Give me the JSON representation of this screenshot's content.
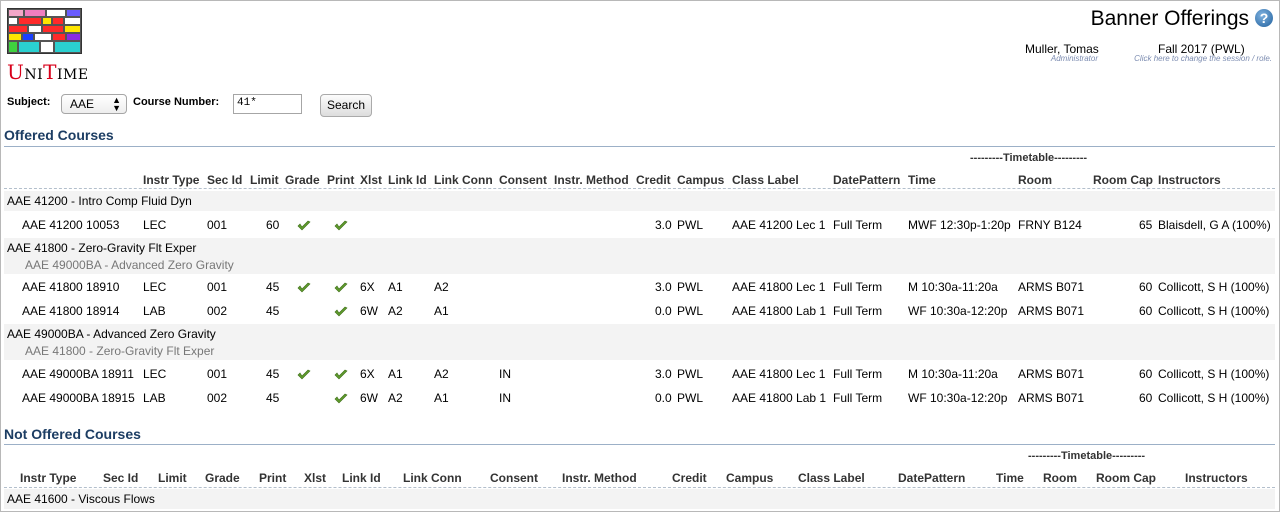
{
  "app": {
    "logo_text": "UniTime"
  },
  "header": {
    "title": "Banner Offerings",
    "help_icon": "help-icon",
    "user_name": "Muller, Tomas",
    "user_role": "Administrator",
    "session": "Fall 2017 (PWL)",
    "session_hint": "Click here to change the session / role."
  },
  "filter": {
    "subject_label": "Subject:",
    "subject_value": "AAE",
    "course_label": "Course Number:",
    "course_value": "41*",
    "search_label": "Search"
  },
  "offered": {
    "section_title": "Offered Courses",
    "timetable_label": "---------Timetable---------",
    "columns": [
      "Instr Type",
      "Sec Id",
      "Limit",
      "Grade",
      "Print",
      "Xlst",
      "Link Id",
      "Link Conn",
      "Consent",
      "Instr. Method",
      "Credit",
      "Campus",
      "Class Label",
      "DatePattern",
      "Time",
      "Room",
      "Room Cap",
      "Instructors"
    ],
    "groups": [
      {
        "title": "AAE 41200 - Intro Comp Fluid Dyn",
        "subtitle": "",
        "rows": [
          {
            "course": "AAE 41200 10053",
            "itype": "LEC",
            "sec": "001",
            "limit": "60",
            "grade": true,
            "print": true,
            "xlst": "",
            "linkid": "",
            "linkconn": "",
            "consent": "",
            "method": "",
            "credit": "3.0",
            "campus": "PWL",
            "label": "AAE 41200 Lec 1",
            "pattern": "Full Term",
            "time": "MWF 12:30p-1:20p",
            "room": "FRNY B124",
            "cap": "65",
            "instr": "Blaisdell, G A (100%)"
          }
        ]
      },
      {
        "title": "AAE 41800 - Zero-Gravity Flt Exper",
        "subtitle": "AAE 49000BA - Advanced Zero Gravity",
        "rows": [
          {
            "course": "AAE 41800 18910",
            "itype": "LEC",
            "sec": "001",
            "limit": "45",
            "grade": true,
            "print": true,
            "xlst": "6X",
            "linkid": "A1",
            "linkconn": "A2",
            "consent": "",
            "method": "",
            "credit": "3.0",
            "campus": "PWL",
            "label": "AAE 41800 Lec 1",
            "pattern": "Full Term",
            "time": "M 10:30a-11:20a",
            "room": "ARMS B071",
            "cap": "60",
            "instr": "Collicott, S H (100%)"
          },
          {
            "course": "AAE 41800 18914",
            "itype": "LAB",
            "sec": "002",
            "limit": "45",
            "grade": false,
            "print": true,
            "xlst": "6W",
            "linkid": "A2",
            "linkconn": "A1",
            "consent": "",
            "method": "",
            "credit": "0.0",
            "campus": "PWL",
            "label": "AAE 41800 Lab 1",
            "pattern": "Full Term",
            "time": "WF 10:30a-12:20p",
            "room": "ARMS B071",
            "cap": "60",
            "instr": "Collicott, S H (100%)"
          }
        ]
      },
      {
        "title": "AAE 49000BA - Advanced Zero Gravity",
        "subtitle": "AAE 41800 - Zero-Gravity Flt Exper",
        "rows": [
          {
            "course": "AAE 49000BA 18911",
            "itype": "LEC",
            "sec": "001",
            "limit": "45",
            "grade": true,
            "print": true,
            "xlst": "6X",
            "linkid": "A1",
            "linkconn": "A2",
            "consent": "IN",
            "method": "",
            "credit": "3.0",
            "campus": "PWL",
            "label": "AAE 41800 Lec 1",
            "pattern": "Full Term",
            "time": "M 10:30a-11:20a",
            "room": "ARMS B071",
            "cap": "60",
            "instr": "Collicott, S H (100%)"
          },
          {
            "course": "AAE 49000BA 18915",
            "itype": "LAB",
            "sec": "002",
            "limit": "45",
            "grade": false,
            "print": true,
            "xlst": "6W",
            "linkid": "A2",
            "linkconn": "A1",
            "consent": "IN",
            "method": "",
            "credit": "0.0",
            "campus": "PWL",
            "label": "AAE 41800 Lab 1",
            "pattern": "Full Term",
            "time": "WF 10:30a-12:20p",
            "room": "ARMS B071",
            "cap": "60",
            "instr": "Collicott, S H (100%)"
          }
        ]
      }
    ]
  },
  "not_offered": {
    "section_title": "Not Offered Courses",
    "timetable_label": "---------Timetable---------",
    "columns": [
      "Instr Type",
      "Sec Id",
      "Limit",
      "Grade",
      "Print",
      "Xlst",
      "Link Id",
      "Link Conn",
      "Consent",
      "Instr. Method",
      "Credit",
      "Campus",
      "Class Label",
      "DatePattern",
      "Time",
      "Room",
      "Room Cap",
      "Instructors"
    ],
    "groups": [
      {
        "title": "AAE 41600 - Viscous Flows"
      }
    ]
  },
  "colors": {
    "section_title": "#1c3d63",
    "check": "#5f9b2d",
    "group_bg": "#f3f3f3"
  }
}
